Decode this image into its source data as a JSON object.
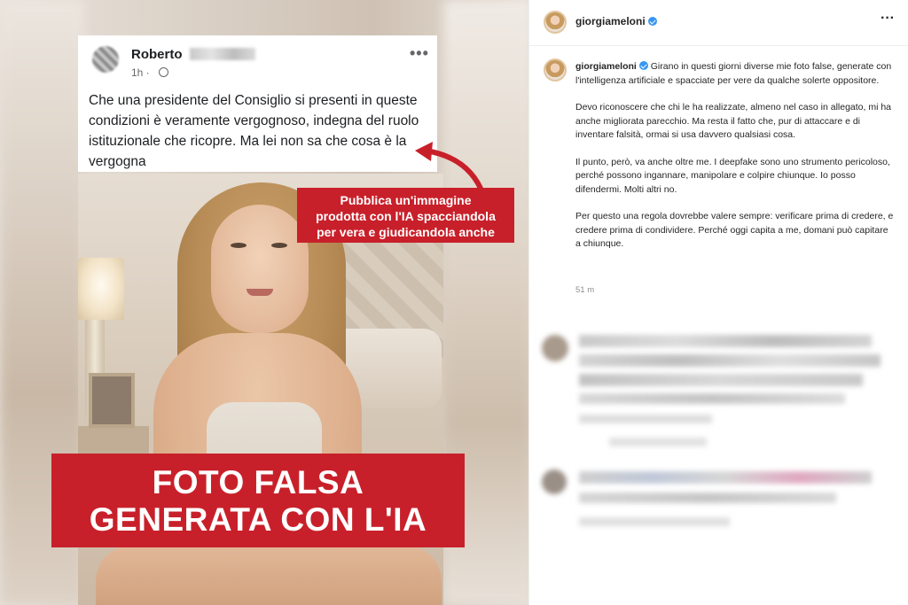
{
  "facebook_comment": {
    "author_first_name": "Roberto",
    "time": "1h ·",
    "text": "Che una presidente del Consiglio  si presenti in queste condizioni è veramente vergognoso, indegna del ruolo istituzionale che ricopre. Ma lei non sa che cosa è la vergogna",
    "more_icon": "•••"
  },
  "callout": {
    "text": "Pubblica un'immagine\nprodotta con l'IA spacciandola\nper vera e giudicandola anche"
  },
  "banner": {
    "text": "FOTO FALSA\nGENERATA CON L'IA"
  },
  "instagram": {
    "header": {
      "username": "giorgiameloni",
      "more_icon": "···"
    },
    "caption": {
      "username": "giorgiameloni",
      "paragraphs": [
        "Girano in questi giorni diverse mie foto false, generate con l'intelligenza artificiale e spacciate per vere da qualche solerte oppositore.",
        "Devo riconoscere che chi le ha realizzate, almeno nel caso in allegato, mi ha anche migliorata parecchio. Ma resta il fatto che, pur di attaccare e di inventare falsità, ormai si usa davvero qualsiasi cosa.",
        "Il punto, però, va anche oltre me. I deepfake sono uno strumento pericoloso, perché possono ingannare, manipolare e colpire chiunque. Io posso difendermi. Molti altri no.",
        "Per questo una regola dovrebbe valere sempre: verificare prima di credere, e credere prima di condividere. Perché oggi capita a me, domani può capitare a chiunque."
      ]
    },
    "time": "51 m"
  },
  "colors": {
    "accent_red": "#c8202a",
    "verified_blue": "#3897f0"
  },
  "icons": [
    "fb-more-icon",
    "globe-icon",
    "verified-icon",
    "ig-more-icon",
    "arrow-icon"
  ]
}
